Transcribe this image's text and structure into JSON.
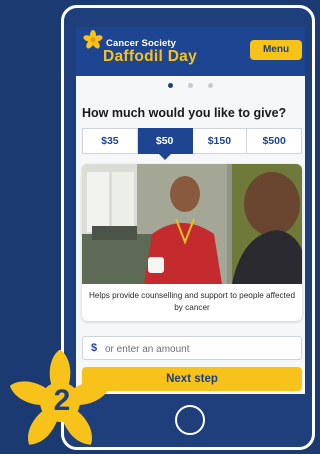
{
  "header": {
    "logo_top": "Cancer Society",
    "logo_main": "Daffodil Day",
    "menu_label": "Menu"
  },
  "carousel": {
    "count": 3,
    "active_index": 0
  },
  "donation": {
    "question": "How much would you like to give?",
    "amounts": [
      "$35",
      "$50",
      "$150",
      "$500"
    ],
    "selected_amount": "$50"
  },
  "impact_card": {
    "caption": "Helps provide counselling and support to people affected by cancer"
  },
  "custom_amount": {
    "currency_symbol": "$",
    "placeholder": "or enter an amount",
    "value": ""
  },
  "next_label": "Next step",
  "step_badge": {
    "number": "2"
  },
  "colors": {
    "brand_blue": "#1e4591",
    "brand_yellow": "#f7c21a",
    "background_navy": "#1c3a72"
  },
  "icons": [
    "daffodil-logo-icon",
    "home-button-icon",
    "daffodil-badge-icon"
  ]
}
